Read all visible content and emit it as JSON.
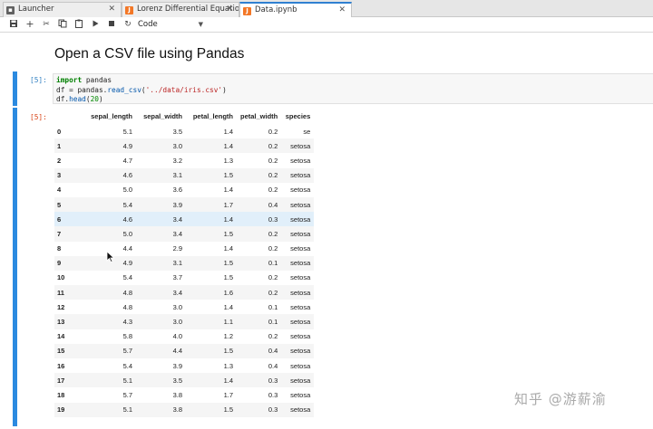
{
  "tabs": [
    {
      "label": "Launcher",
      "icon": "launcher-icon",
      "active": false
    },
    {
      "label": "Lorenz Differential Equatio",
      "icon": "notebook-icon",
      "active": false
    },
    {
      "label": "Data.ipynb",
      "icon": "notebook-icon",
      "active": true
    }
  ],
  "toolbar": {
    "cell_type": "Code",
    "icons": [
      "save-icon",
      "add-cell-icon",
      "cut-icon",
      "copy-icon",
      "paste-icon",
      "run-icon",
      "stop-icon",
      "restart-icon"
    ]
  },
  "markdown": {
    "heading": "Open a CSV file using Pandas"
  },
  "code_cell": {
    "prompt": "[5]:",
    "lines": {
      "l1_kw": "import",
      "l1_rest": " pandas",
      "l2_a": "df = pandas.",
      "l2_fn": "read_csv",
      "l2_b": "(",
      "l2_str": "'../data/iris.csv'",
      "l2_c": ")",
      "l3_a": "df.",
      "l3_fn": "head",
      "l3_b": "(",
      "l3_num": "20",
      "l3_c": ")"
    }
  },
  "output_cell": {
    "prompt": "[5]:",
    "columns": [
      "",
      "sepal_length",
      "sepal_width",
      "petal_length",
      "petal_width",
      "species"
    ],
    "rows": [
      [
        "0",
        "5.1",
        "3.5",
        "1.4",
        "0.2",
        "se"
      ],
      [
        "1",
        "4.9",
        "3.0",
        "1.4",
        "0.2",
        "setosa"
      ],
      [
        "2",
        "4.7",
        "3.2",
        "1.3",
        "0.2",
        "setosa"
      ],
      [
        "3",
        "4.6",
        "3.1",
        "1.5",
        "0.2",
        "setosa"
      ],
      [
        "4",
        "5.0",
        "3.6",
        "1.4",
        "0.2",
        "setosa"
      ],
      [
        "5",
        "5.4",
        "3.9",
        "1.7",
        "0.4",
        "setosa"
      ],
      [
        "6",
        "4.6",
        "3.4",
        "1.4",
        "0.3",
        "setosa"
      ],
      [
        "7",
        "5.0",
        "3.4",
        "1.5",
        "0.2",
        "setosa"
      ],
      [
        "8",
        "4.4",
        "2.9",
        "1.4",
        "0.2",
        "setosa"
      ],
      [
        "9",
        "4.9",
        "3.1",
        "1.5",
        "0.1",
        "setosa"
      ],
      [
        "10",
        "5.4",
        "3.7",
        "1.5",
        "0.2",
        "setosa"
      ],
      [
        "11",
        "4.8",
        "3.4",
        "1.6",
        "0.2",
        "setosa"
      ],
      [
        "12",
        "4.8",
        "3.0",
        "1.4",
        "0.1",
        "setosa"
      ],
      [
        "13",
        "4.3",
        "3.0",
        "1.1",
        "0.1",
        "setosa"
      ],
      [
        "14",
        "5.8",
        "4.0",
        "1.2",
        "0.2",
        "setosa"
      ],
      [
        "15",
        "5.7",
        "4.4",
        "1.5",
        "0.4",
        "setosa"
      ],
      [
        "16",
        "5.4",
        "3.9",
        "1.3",
        "0.4",
        "setosa"
      ],
      [
        "17",
        "5.1",
        "3.5",
        "1.4",
        "0.3",
        "setosa"
      ],
      [
        "18",
        "5.7",
        "3.8",
        "1.7",
        "0.3",
        "setosa"
      ],
      [
        "19",
        "5.1",
        "3.8",
        "1.5",
        "0.3",
        "setosa"
      ]
    ],
    "hover_row": 6
  },
  "watermark": "知乎 @游薪渝",
  "colors": {
    "accent": "#2b8ae0",
    "notebook_icon": "#f37726"
  }
}
